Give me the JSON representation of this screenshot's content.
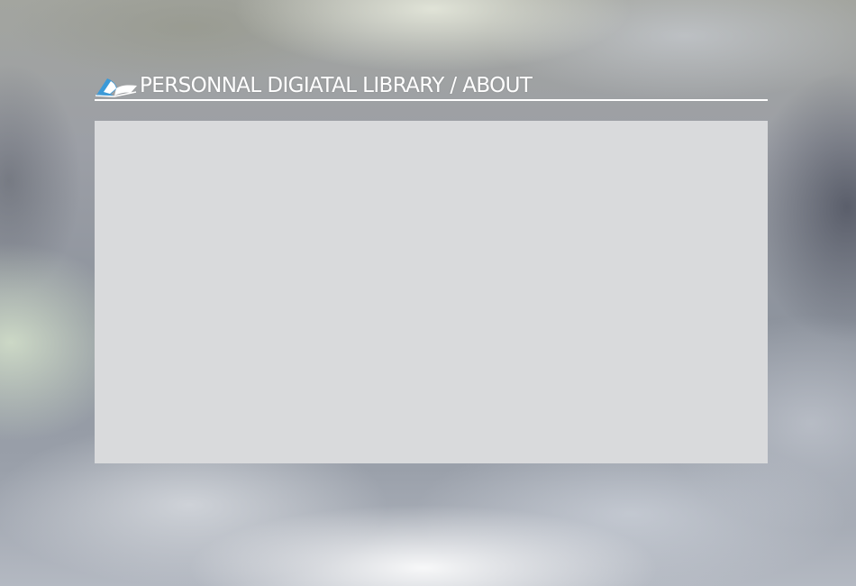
{
  "header": {
    "logo_icon": "open-book-icon",
    "title": "PERSONNAL DIGIATAL LIBRARY / ABOUT"
  },
  "colors": {
    "title_text": "#ffffff",
    "underline": "#ffffff",
    "panel_background": "#d9dadc",
    "logo_blue": "#3b9ad8"
  },
  "content_panel": {
    "text": ""
  }
}
